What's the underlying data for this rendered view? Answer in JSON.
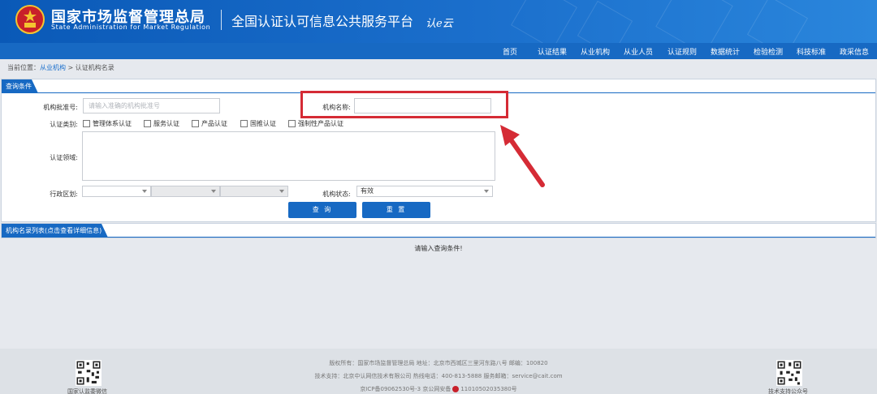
{
  "header": {
    "org_name_cn": "国家市场监督管理总局",
    "org_name_en": "State Administration  for  Market Regulation",
    "platform_title": "全国认证认可信息公共服务平台",
    "logo_text": "认e云",
    "brand_color": "#1769c3"
  },
  "nav": {
    "items": [
      "首页",
      "认证结果",
      "从业机构",
      "从业人员",
      "认证规则",
      "数据统计",
      "检验检测",
      "科技标准",
      "政采信息"
    ]
  },
  "breadcrumb": {
    "prefix": "当前位置：",
    "crumbs": [
      "从业机构",
      "认证机构名录"
    ],
    "separator": ">"
  },
  "query_panel": {
    "title": "查询条件",
    "approval_no_label": "机构批准号:",
    "approval_no_placeholder": "请输入准确的机构批准号",
    "approval_no_value": "",
    "org_name_label": "机构名称:",
    "org_name_value": "",
    "cert_type_label": "认证类别:",
    "cert_types": [
      "管理体系认证",
      "服务认证",
      "产品认证",
      "国推认证",
      "强制性产品认证"
    ],
    "cert_field_label": "认证领域:",
    "region_label": "行政区划:",
    "status_label": "机构状态:",
    "status_value": "有效",
    "query_button": "查 询",
    "reset_button": "重 置"
  },
  "result_panel": {
    "title": "机构名录列表(点击查看详细信息)",
    "empty_message": "请输入查询条件!"
  },
  "footer": {
    "left_qr_label": "国家认监委微信",
    "right_qr_label": "技术支持公众号",
    "line1": "版权所有：国家市场监督管理总局    地址：北京市西城区三里河东路八号    邮编：100820",
    "line2": "技术支持：北京中认网信技术有限公司    热线电话：400-813-5888    服务邮箱：service@cait.com",
    "line3_a": "京ICP备09062530号-3    京公网安备",
    "line3_b": "11010502035380号"
  },
  "annotation_color": "#d52b35"
}
